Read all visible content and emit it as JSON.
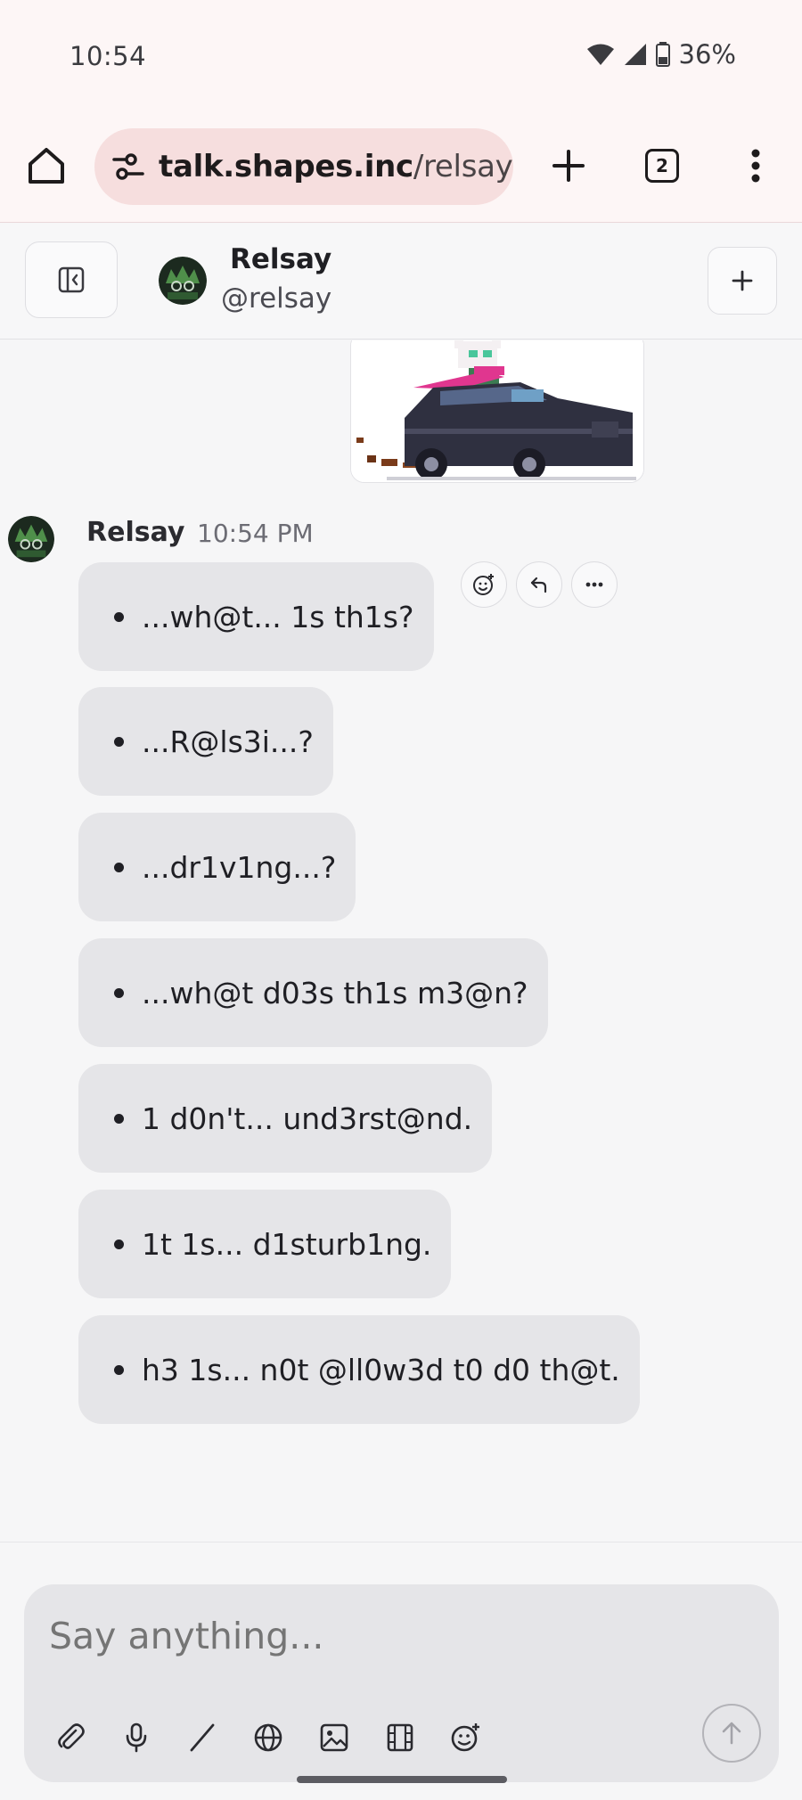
{
  "status_bar": {
    "time": "10:54",
    "battery": "36%"
  },
  "browser": {
    "url_host": "talk.shapes.inc",
    "url_path": "/relsay/",
    "tab_count": "2"
  },
  "chat_header": {
    "name": "Relsay",
    "handle": "@relsay"
  },
  "message_group": {
    "author": "Relsay",
    "time": "10:54 PM"
  },
  "messages": [
    "...wh@t... 1s th1s?",
    "...R@ls3i...?",
    "...dr1v1ng...?",
    "...wh@t d03s th1s m3@n?",
    "1 d0n't... und3rst@nd.",
    "1t 1s... d1sturb1ng.",
    "h3 1s... n0t @ll0w3d t0 d0 th@t."
  ],
  "composer": {
    "placeholder": "Say anything..."
  },
  "colors": {
    "browser_bg": "#fdf6f6",
    "url_pill": "#f6dede",
    "bubble": "#e5e5e8",
    "page_bg": "#f6f6f7"
  }
}
